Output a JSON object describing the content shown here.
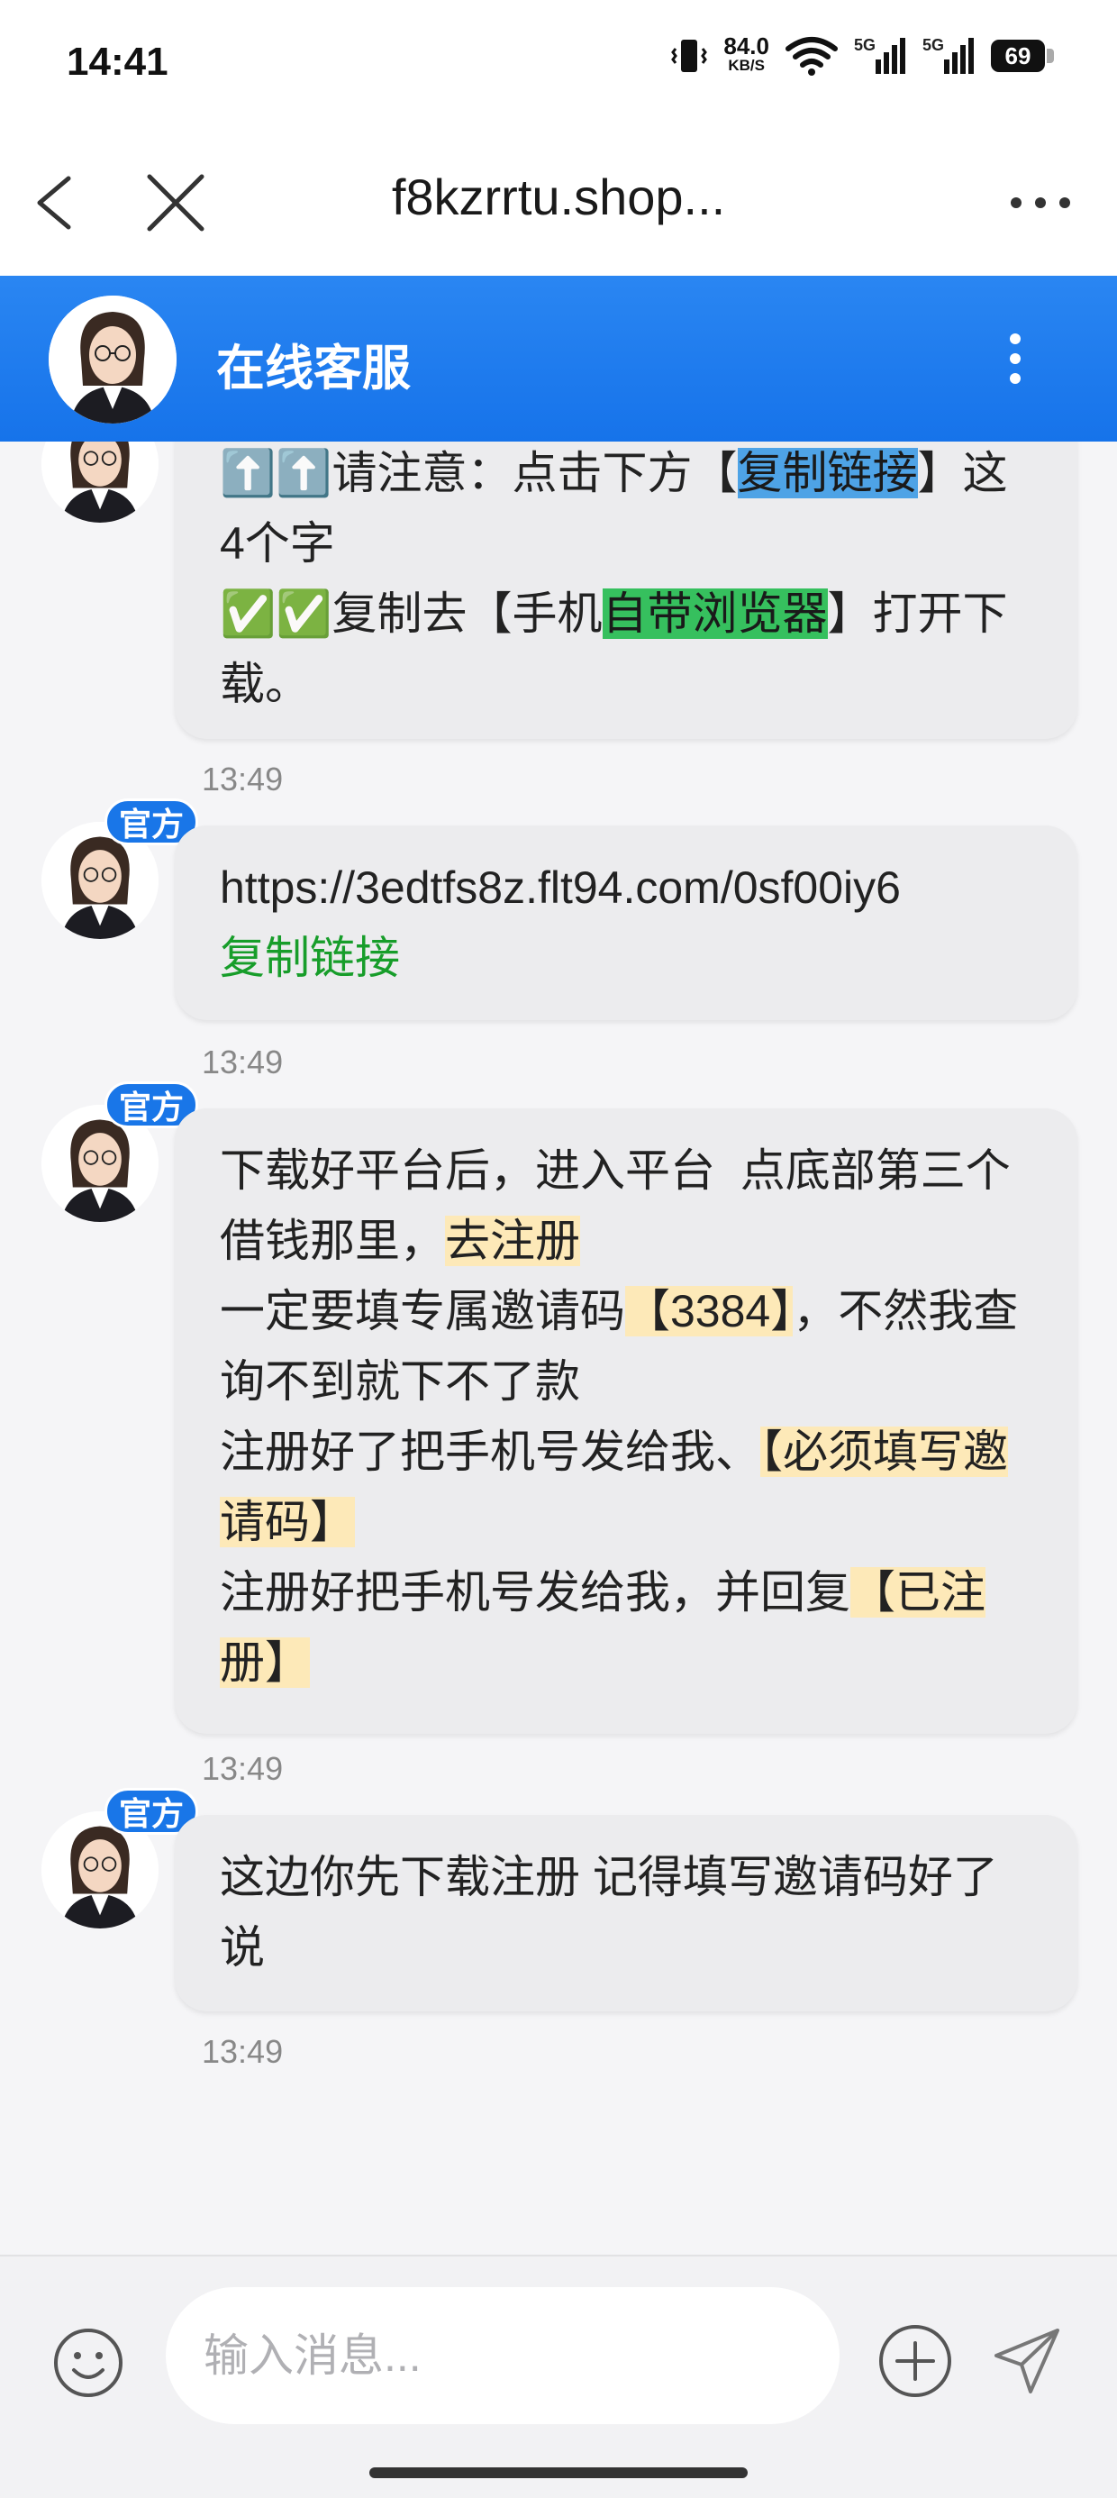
{
  "status_bar": {
    "time": "14:41",
    "net_speed": "84.0",
    "net_unit": "KB/S",
    "signal1": "5G",
    "signal2": "5G",
    "battery": "69"
  },
  "browser": {
    "url": "f8kzrrtu.shop..."
  },
  "chat_header": {
    "title": "在线客服"
  },
  "messages": [
    {
      "lines": [
        "⬆️⬆️请注意：点击下方【",
        "复制链接",
        "】这4个字",
        "✅✅复制去【手机",
        "自带浏览器",
        "】打开下载。"
      ],
      "time": "13:49"
    },
    {
      "badge": "官方",
      "url": "https://3edtfs8z.flt94.com/0sf00iy6",
      "link_label": "复制链接",
      "time": "13:49"
    },
    {
      "badge": "官方",
      "lines": [
        "下载好平台后，进入平台  点底部第三个借钱那里，",
        "去注册",
        "一定要填专属邀请码",
        "【3384】",
        "，不然我查询不到就下不了款",
        "注册好了把手机号发给我、",
        "【必须填写邀请码】",
        "注册好把手机号发给我，并回复",
        "【已注册】"
      ],
      "time": "13:49"
    },
    {
      "badge": "官方",
      "lines": [
        "这边你先下载注册 记得填写邀请码好了说"
      ],
      "time": "13:49"
    }
  ],
  "input_bar": {
    "placeholder": "输入消息..."
  },
  "icons": {
    "back": "chevron-left-icon",
    "close": "close-icon",
    "more": "more-horizontal-icon",
    "menu": "more-vertical-icon",
    "emoji": "emoji-icon",
    "plus": "plus-circle-icon",
    "send": "send-icon"
  },
  "colors": {
    "header": "#1a7bee",
    "badge": "#1976e8",
    "highlight_blue": "#4ea3e6",
    "highlight_green": "#36c05e",
    "highlight_yellow": "#fde9b8",
    "link_green": "#179d2a"
  }
}
